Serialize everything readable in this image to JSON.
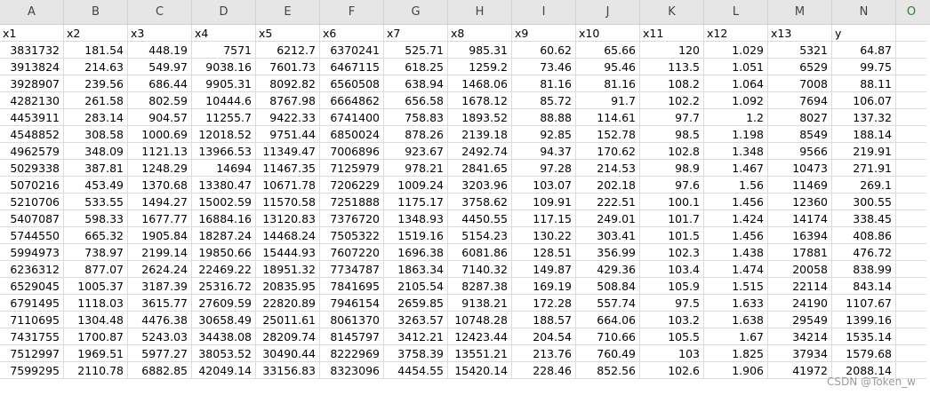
{
  "column_letters": [
    "A",
    "B",
    "C",
    "D",
    "E",
    "F",
    "G",
    "H",
    "I",
    "J",
    "K",
    "L",
    "M",
    "N",
    "O"
  ],
  "headers": [
    "x1",
    "x2",
    "x3",
    "x4",
    "x5",
    "x6",
    "x7",
    "x8",
    "x9",
    "x10",
    "x11",
    "x12",
    "x13",
    "y"
  ],
  "rows": [
    [
      "3831732",
      "181.54",
      "448.19",
      "7571",
      "6212.7",
      "6370241",
      "525.71",
      "985.31",
      "60.62",
      "65.66",
      "120",
      "1.029",
      "5321",
      "64.87"
    ],
    [
      "3913824",
      "214.63",
      "549.97",
      "9038.16",
      "7601.73",
      "6467115",
      "618.25",
      "1259.2",
      "73.46",
      "95.46",
      "113.5",
      "1.051",
      "6529",
      "99.75"
    ],
    [
      "3928907",
      "239.56",
      "686.44",
      "9905.31",
      "8092.82",
      "6560508",
      "638.94",
      "1468.06",
      "81.16",
      "81.16",
      "108.2",
      "1.064",
      "7008",
      "88.11"
    ],
    [
      "4282130",
      "261.58",
      "802.59",
      "10444.6",
      "8767.98",
      "6664862",
      "656.58",
      "1678.12",
      "85.72",
      "91.7",
      "102.2",
      "1.092",
      "7694",
      "106.07"
    ],
    [
      "4453911",
      "283.14",
      "904.57",
      "11255.7",
      "9422.33",
      "6741400",
      "758.83",
      "1893.52",
      "88.88",
      "114.61",
      "97.7",
      "1.2",
      "8027",
      "137.32"
    ],
    [
      "4548852",
      "308.58",
      "1000.69",
      "12018.52",
      "9751.44",
      "6850024",
      "878.26",
      "2139.18",
      "92.85",
      "152.78",
      "98.5",
      "1.198",
      "8549",
      "188.14"
    ],
    [
      "4962579",
      "348.09",
      "1121.13",
      "13966.53",
      "11349.47",
      "7006896",
      "923.67",
      "2492.74",
      "94.37",
      "170.62",
      "102.8",
      "1.348",
      "9566",
      "219.91"
    ],
    [
      "5029338",
      "387.81",
      "1248.29",
      "14694",
      "11467.35",
      "7125979",
      "978.21",
      "2841.65",
      "97.28",
      "214.53",
      "98.9",
      "1.467",
      "10473",
      "271.91"
    ],
    [
      "5070216",
      "453.49",
      "1370.68",
      "13380.47",
      "10671.78",
      "7206229",
      "1009.24",
      "3203.96",
      "103.07",
      "202.18",
      "97.6",
      "1.56",
      "11469",
      "269.1"
    ],
    [
      "5210706",
      "533.55",
      "1494.27",
      "15002.59",
      "11570.58",
      "7251888",
      "1175.17",
      "3758.62",
      "109.91",
      "222.51",
      "100.1",
      "1.456",
      "12360",
      "300.55"
    ],
    [
      "5407087",
      "598.33",
      "1677.77",
      "16884.16",
      "13120.83",
      "7376720",
      "1348.93",
      "4450.55",
      "117.15",
      "249.01",
      "101.7",
      "1.424",
      "14174",
      "338.45"
    ],
    [
      "5744550",
      "665.32",
      "1905.84",
      "18287.24",
      "14468.24",
      "7505322",
      "1519.16",
      "5154.23",
      "130.22",
      "303.41",
      "101.5",
      "1.456",
      "16394",
      "408.86"
    ],
    [
      "5994973",
      "738.97",
      "2199.14",
      "19850.66",
      "15444.93",
      "7607220",
      "1696.38",
      "6081.86",
      "128.51",
      "356.99",
      "102.3",
      "1.438",
      "17881",
      "476.72"
    ],
    [
      "6236312",
      "877.07",
      "2624.24",
      "22469.22",
      "18951.32",
      "7734787",
      "1863.34",
      "7140.32",
      "149.87",
      "429.36",
      "103.4",
      "1.474",
      "20058",
      "838.99"
    ],
    [
      "6529045",
      "1005.37",
      "3187.39",
      "25316.72",
      "20835.95",
      "7841695",
      "2105.54",
      "8287.38",
      "169.19",
      "508.84",
      "105.9",
      "1.515",
      "22114",
      "843.14"
    ],
    [
      "6791495",
      "1118.03",
      "3615.77",
      "27609.59",
      "22820.89",
      "7946154",
      "2659.85",
      "9138.21",
      "172.28",
      "557.74",
      "97.5",
      "1.633",
      "24190",
      "1107.67"
    ],
    [
      "7110695",
      "1304.48",
      "4476.38",
      "30658.49",
      "25011.61",
      "8061370",
      "3263.57",
      "10748.28",
      "188.57",
      "664.06",
      "103.2",
      "1.638",
      "29549",
      "1399.16"
    ],
    [
      "7431755",
      "1700.87",
      "5243.03",
      "34438.08",
      "28209.74",
      "8145797",
      "3412.21",
      "12423.44",
      "204.54",
      "710.66",
      "105.5",
      "1.67",
      "34214",
      "1535.14"
    ],
    [
      "7512997",
      "1969.51",
      "5977.27",
      "38053.52",
      "30490.44",
      "8222969",
      "3758.39",
      "13551.21",
      "213.76",
      "760.49",
      "103",
      "1.825",
      "37934",
      "1579.68"
    ],
    [
      "7599295",
      "2110.78",
      "6882.85",
      "42049.14",
      "33156.83",
      "8323096",
      "4454.55",
      "15420.14",
      "228.46",
      "852.56",
      "102.6",
      "1.906",
      "41972",
      "2088.14"
    ]
  ],
  "watermark": "CSDN @Token_w"
}
